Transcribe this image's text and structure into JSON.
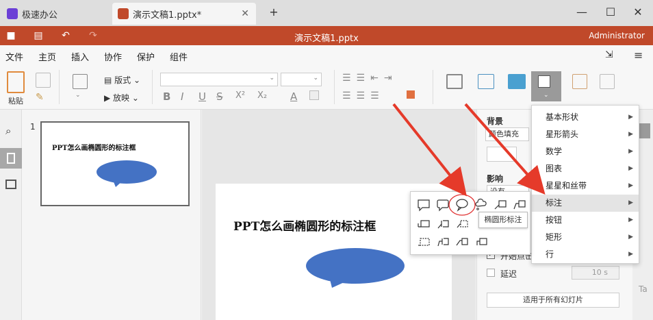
{
  "tabs": [
    {
      "label": "极速办公"
    },
    {
      "label": "演示文稿1.pptx*"
    }
  ],
  "window": {
    "title": "演示文稿1.pptx",
    "user": "Administrator"
  },
  "menu": [
    "文件",
    "主页",
    "插入",
    "协作",
    "保护",
    "组件"
  ],
  "ribbon": {
    "paste": "粘贴",
    "layout": "版式",
    "slideshow": "放映",
    "bold": "B",
    "italic": "I",
    "underline": "U",
    "strike": "S",
    "superscript": "X²",
    "subscript": "X₂",
    "fontcolor": "A"
  },
  "slide": {
    "number": "1",
    "title": "PPT怎么画椭圆形的标注框"
  },
  "rightpane": {
    "background": "背景",
    "fill": "颜色填充",
    "effect": "影响",
    "none": "没有",
    "start": "开始点击",
    "delay": "延迟",
    "delay_value": "10 s",
    "apply_all": "适用于所有幻灯片"
  },
  "shape_menu": [
    "基本形状",
    "星形箭头",
    "数学",
    "图表",
    "星星和丝带",
    "标注",
    "按钮",
    "矩形",
    "行"
  ],
  "tooltip": "椭圆形标注",
  "colors": {
    "accent": "#c0492a",
    "shape": "#4472c4"
  }
}
